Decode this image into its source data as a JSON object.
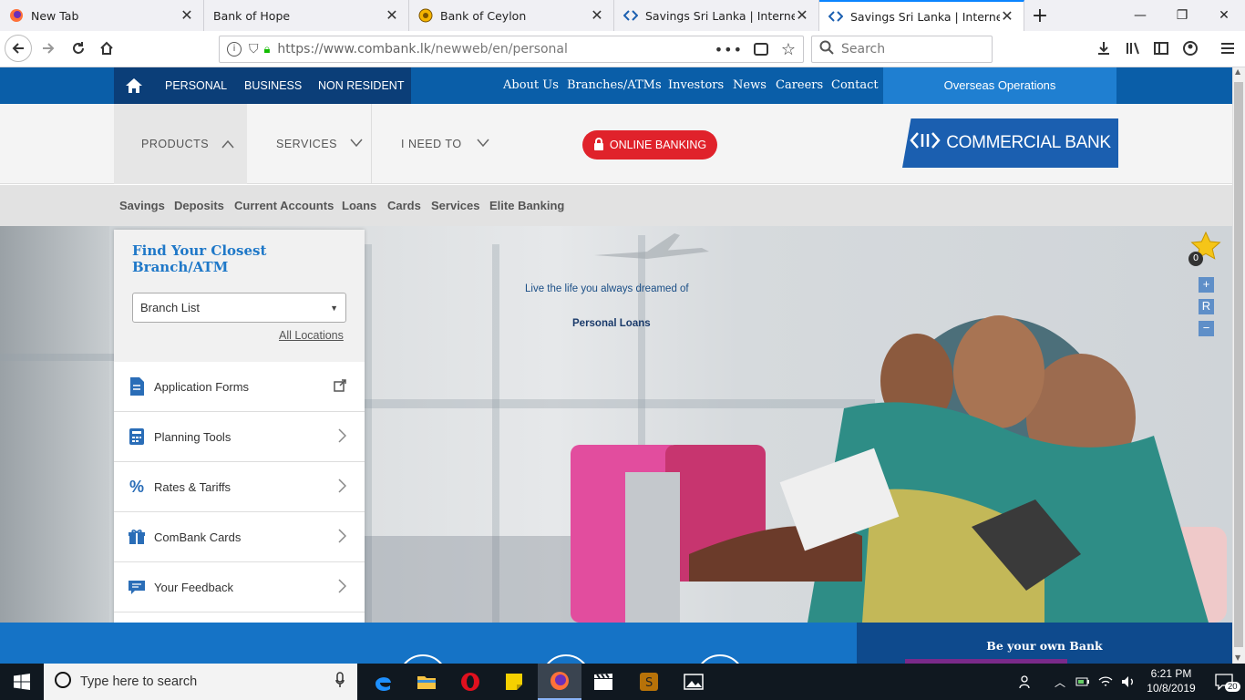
{
  "browser": {
    "tabs": [
      {
        "label": "New Tab",
        "icon": "firefox-icon"
      },
      {
        "label": "Bank of Hope",
        "icon": "blank-icon"
      },
      {
        "label": "Bank of Ceylon",
        "icon": "boc-icon"
      },
      {
        "label": "Savings Sri Lanka | Internet Ban",
        "icon": "combank-icon"
      },
      {
        "label": "Savings Sri Lanka | Internet Ban",
        "icon": "combank-icon",
        "active": true
      }
    ],
    "url": "https://www.combank.lk/newweb/en/personal",
    "url_host": "https://www.combank.lk",
    "url_path": "/newweb/en/personal",
    "search_placeholder": "Search"
  },
  "site": {
    "segments": [
      "PERSONAL",
      "BUSINESS",
      "NON RESIDENT"
    ],
    "top_links": [
      "About Us",
      "Branches/ATMs",
      "Investors",
      "News",
      "Careers",
      "Contact"
    ],
    "overseas": "Overseas Operations",
    "mega_tabs": [
      "PRODUCTS",
      "SERVICES",
      "I NEED TO"
    ],
    "online_banking": "ONLINE BANKING",
    "logo_text": "COMMERCIAL BANK",
    "sub_menu": [
      "Savings",
      "Deposits",
      "Current Accounts",
      "Loans",
      "Cards",
      "Services",
      "Elite Banking"
    ],
    "hero": {
      "tagline": "Live the life you always dreamed of",
      "title": "Personal Loans"
    },
    "panel": {
      "title": "Find Your Closest Branch/ATM",
      "branch_select": "Branch List",
      "all_locations": "All Locations",
      "links": [
        "Application Forms",
        "Planning Tools",
        "Rates & Tariffs",
        "ComBank Cards",
        "Your Feedback"
      ]
    },
    "favourites_count": "0",
    "zoom": {
      "plus": "+",
      "reset": "R",
      "minus": "−"
    },
    "be_your_own_bank": "Be your own Bank"
  },
  "taskbar": {
    "search_placeholder": "Type here to search",
    "time": "6:21 PM",
    "date": "10/8/2019",
    "notifications": "20"
  },
  "colors": {
    "brand_blue": "#0a5ea8",
    "dark_blue": "#0b3e78",
    "online_red": "#e0222b",
    "link_blue": "#1f78c8"
  }
}
